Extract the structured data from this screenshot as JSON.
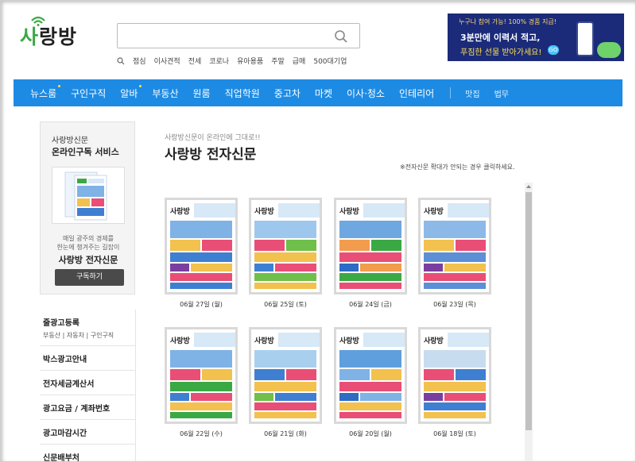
{
  "header": {
    "logo_text_a": "사",
    "logo_text_b": "랑방",
    "search_placeholder": "",
    "keywords": [
      "점심",
      "이사견적",
      "전세",
      "코로나",
      "유아용품",
      "주말",
      "급매",
      "500대기업"
    ]
  },
  "banner": {
    "line1": "누구나 참여 가능! 100% 경품 지급!",
    "line2": "3분만에 이력서 적고,",
    "line3": "푸짐한 선물 받아가세요!",
    "go": "GO"
  },
  "nav": {
    "items": [
      {
        "label": "뉴스룸",
        "dot": true
      },
      {
        "label": "구인구직",
        "dot": false
      },
      {
        "label": "알바",
        "dot": true
      },
      {
        "label": "부동산",
        "dot": false
      },
      {
        "label": "원룸",
        "dot": false
      },
      {
        "label": "직업학원",
        "dot": false
      },
      {
        "label": "중고차",
        "dot": false
      },
      {
        "label": "마켓",
        "dot": false
      },
      {
        "label": "이사·청소",
        "dot": false
      },
      {
        "label": "인테리어",
        "dot": false
      }
    ],
    "small_items": [
      "맛집",
      "법무"
    ]
  },
  "sidebar": {
    "title1": "사랑방신문",
    "title2": "온라인구독 서비스",
    "desc1": "매일 광주의 경제를",
    "desc2": "한눈에 챙겨주는 길잡이",
    "name": "사랑방 전자신문",
    "subscribe_button": "구독하기",
    "menu": [
      {
        "title": "줄광고등록",
        "sub": "부동산 | 자동차 | 구인구직"
      },
      {
        "title": "박스광고안내",
        "sub": ""
      },
      {
        "title": "전자세금계산서",
        "sub": ""
      },
      {
        "title": "광고요금 / 계좌번호",
        "sub": ""
      },
      {
        "title": "광고마감시간",
        "sub": ""
      },
      {
        "title": "신문배부처",
        "sub": ""
      }
    ]
  },
  "main": {
    "intro": "사랑방신문이 온라인에 그대로!!",
    "title": "사랑방 전자신문",
    "note": "※전자신문 확대가 안되는 경우 클릭하세요.",
    "mast_text": "사랑방",
    "papers": [
      {
        "date": "06월 27일 (월)"
      },
      {
        "date": "06월 25일 (토)"
      },
      {
        "date": "06월 24일 (금)"
      },
      {
        "date": "06월 23일 (목)"
      },
      {
        "date": "06월 22일 (수)"
      },
      {
        "date": "06월 21일 (화)"
      },
      {
        "date": "06월 20일 (월)"
      },
      {
        "date": "06월 18일 (토)"
      }
    ]
  },
  "colors": {
    "nav_blue": "#1d8be4",
    "logo_green": "#3aa944",
    "banner_navy": "#1b2b7a"
  }
}
